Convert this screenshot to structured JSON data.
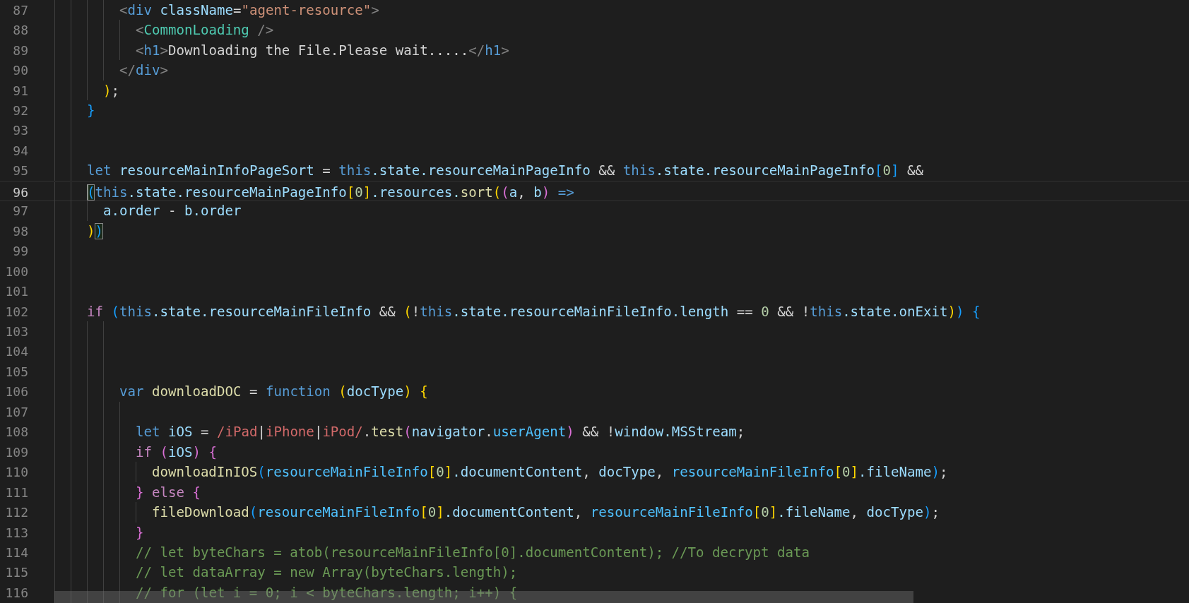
{
  "editor": {
    "lines": [
      {
        "number": "87",
        "current": false,
        "tokens": [
          {
            "text": "        <",
            "kind": "tag"
          },
          {
            "text": "div",
            "kind": "kw"
          },
          {
            "text": " className",
            "kind": "var"
          },
          {
            "text": "=",
            "kind": "plain"
          },
          {
            "text": "\"agent-resource\"",
            "kind": "str"
          },
          {
            "text": ">",
            "kind": "tag"
          }
        ]
      },
      {
        "number": "88",
        "current": false,
        "tokens": [
          {
            "text": "          <",
            "kind": "tag"
          },
          {
            "text": "CommonLoading",
            "kind": "comp"
          },
          {
            "text": " />",
            "kind": "tag"
          }
        ]
      },
      {
        "number": "89",
        "current": false,
        "tokens": [
          {
            "text": "          <",
            "kind": "tag"
          },
          {
            "text": "h1",
            "kind": "kw"
          },
          {
            "text": ">",
            "kind": "tag"
          },
          {
            "text": "Downloading the File.Please wait.....",
            "kind": "plain"
          },
          {
            "text": "</",
            "kind": "tag"
          },
          {
            "text": "h1",
            "kind": "kw"
          },
          {
            "text": ">",
            "kind": "tag"
          }
        ]
      },
      {
        "number": "90",
        "current": false,
        "tokens": [
          {
            "text": "        </",
            "kind": "tag"
          },
          {
            "text": "div",
            "kind": "kw"
          },
          {
            "text": ">",
            "kind": "tag"
          }
        ]
      },
      {
        "number": "91",
        "current": false,
        "tokens": [
          {
            "text": "      )",
            "kind": "b1"
          },
          {
            "text": ";",
            "kind": "plain"
          }
        ]
      },
      {
        "number": "92",
        "current": false,
        "tokens": [
          {
            "text": "    }",
            "kind": "b3"
          }
        ]
      },
      {
        "number": "93",
        "current": false
      },
      {
        "number": "94",
        "current": false
      },
      {
        "number": "95",
        "current": false,
        "tokens": [
          {
            "text": "    let",
            "kind": "kw"
          },
          {
            "text": " resourceMainInfoPageSort",
            "kind": "var"
          },
          {
            "text": " = ",
            "kind": "plain"
          },
          {
            "text": "this",
            "kind": "kw"
          },
          {
            "text": ".state.resourceMainPageInfo",
            "kind": "var"
          },
          {
            "text": " && ",
            "kind": "plain"
          },
          {
            "text": "this",
            "kind": "kw"
          },
          {
            "text": ".state.resourceMainPageInfo",
            "kind": "var"
          },
          {
            "text": "[",
            "kind": "b3"
          },
          {
            "text": "0",
            "kind": "num"
          },
          {
            "text": "]",
            "kind": "b3"
          },
          {
            "text": " &&",
            "kind": "plain"
          }
        ]
      },
      {
        "number": "96",
        "current": true,
        "tokens": [
          {
            "text": "    (",
            "kind": "b3",
            "matched": true
          },
          {
            "text": "this",
            "kind": "kw"
          },
          {
            "text": ".state.resourceMainPageInfo",
            "kind": "var"
          },
          {
            "text": "[",
            "kind": "b1"
          },
          {
            "text": "0",
            "kind": "num"
          },
          {
            "text": "]",
            "kind": "b1"
          },
          {
            "text": ".resources.",
            "kind": "var"
          },
          {
            "text": "sort",
            "kind": "fn"
          },
          {
            "text": "(",
            "kind": "b1"
          },
          {
            "text": "(",
            "kind": "b2"
          },
          {
            "text": "a",
            "kind": "var"
          },
          {
            "text": ", ",
            "kind": "plain"
          },
          {
            "text": "b",
            "kind": "var"
          },
          {
            "text": ")",
            "kind": "b2"
          },
          {
            "text": " =>",
            "kind": "kw"
          }
        ]
      },
      {
        "number": "97",
        "current": false,
        "tokens": [
          {
            "text": "      a.order",
            "kind": "var"
          },
          {
            "text": " - ",
            "kind": "plain"
          },
          {
            "text": "b.order",
            "kind": "var"
          }
        ]
      },
      {
        "number": "98",
        "current": false,
        "tokens": [
          {
            "text": "    )",
            "kind": "b1"
          },
          {
            "text": ")",
            "kind": "b3",
            "matched": true
          }
        ]
      },
      {
        "number": "99",
        "current": false
      },
      {
        "number": "100",
        "current": false
      },
      {
        "number": "101",
        "current": false
      },
      {
        "number": "102",
        "current": false,
        "tokens": [
          {
            "text": "    if ",
            "kind": "ctrl"
          },
          {
            "text": "(",
            "kind": "b3"
          },
          {
            "text": "this",
            "kind": "kw"
          },
          {
            "text": ".state.resourceMainFileInfo",
            "kind": "var"
          },
          {
            "text": " && ",
            "kind": "plain"
          },
          {
            "text": "(",
            "kind": "b1"
          },
          {
            "text": "!",
            "kind": "plain"
          },
          {
            "text": "this",
            "kind": "kw"
          },
          {
            "text": ".state.resourceMainFileInfo.length",
            "kind": "var"
          },
          {
            "text": " == ",
            "kind": "plain"
          },
          {
            "text": "0",
            "kind": "num"
          },
          {
            "text": " && !",
            "kind": "plain"
          },
          {
            "text": "this",
            "kind": "kw"
          },
          {
            "text": ".state.onExit",
            "kind": "var"
          },
          {
            "text": ")",
            "kind": "b1"
          },
          {
            "text": ") ",
            "kind": "b3"
          },
          {
            "text": "{",
            "kind": "b3"
          }
        ]
      },
      {
        "number": "103",
        "current": false
      },
      {
        "number": "104",
        "current": false
      },
      {
        "number": "105",
        "current": false
      },
      {
        "number": "106",
        "current": false,
        "tokens": [
          {
            "text": "        var",
            "kind": "kw"
          },
          {
            "text": " downloadDOC",
            "kind": "fn"
          },
          {
            "text": " = ",
            "kind": "plain"
          },
          {
            "text": "function ",
            "kind": "kw"
          },
          {
            "text": "(",
            "kind": "b1"
          },
          {
            "text": "docType",
            "kind": "var"
          },
          {
            "text": ") ",
            "kind": "b1"
          },
          {
            "text": "{",
            "kind": "b1"
          }
        ]
      },
      {
        "number": "107",
        "current": false
      },
      {
        "number": "108",
        "current": false,
        "tokens": [
          {
            "text": "          let",
            "kind": "kw"
          },
          {
            "text": " iOS",
            "kind": "var"
          },
          {
            "text": " = ",
            "kind": "plain"
          },
          {
            "text": "/iPad",
            "kind": "regex"
          },
          {
            "text": "|",
            "kind": "plain"
          },
          {
            "text": "iPhone",
            "kind": "regex"
          },
          {
            "text": "|",
            "kind": "plain"
          },
          {
            "text": "iPod/",
            "kind": "regex"
          },
          {
            "text": ".",
            "kind": "plain"
          },
          {
            "text": "test",
            "kind": "fn"
          },
          {
            "text": "(",
            "kind": "b2"
          },
          {
            "text": "navigator",
            "kind": "var"
          },
          {
            "text": ".",
            "kind": "plain"
          },
          {
            "text": "userAgent",
            "kind": "const"
          },
          {
            "text": ")",
            "kind": "b2"
          },
          {
            "text": " && !",
            "kind": "plain"
          },
          {
            "text": "window.MSStream",
            "kind": "var"
          },
          {
            "text": ";",
            "kind": "plain"
          }
        ]
      },
      {
        "number": "109",
        "current": false,
        "tokens": [
          {
            "text": "          if ",
            "kind": "ctrl"
          },
          {
            "text": "(",
            "kind": "b2"
          },
          {
            "text": "iOS",
            "kind": "var"
          },
          {
            "text": ") ",
            "kind": "b2"
          },
          {
            "text": "{",
            "kind": "b2"
          }
        ]
      },
      {
        "number": "110",
        "current": false,
        "tokens": [
          {
            "text": "            downloadInIOS",
            "kind": "fn"
          },
          {
            "text": "(",
            "kind": "b3"
          },
          {
            "text": "resourceMainFileInfo",
            "kind": "const"
          },
          {
            "text": "[",
            "kind": "b1"
          },
          {
            "text": "0",
            "kind": "num"
          },
          {
            "text": "]",
            "kind": "b1"
          },
          {
            "text": ".documentContent",
            "kind": "var"
          },
          {
            "text": ", ",
            "kind": "plain"
          },
          {
            "text": "docType",
            "kind": "var"
          },
          {
            "text": ", ",
            "kind": "plain"
          },
          {
            "text": "resourceMainFileInfo",
            "kind": "const"
          },
          {
            "text": "[",
            "kind": "b1"
          },
          {
            "text": "0",
            "kind": "num"
          },
          {
            "text": "]",
            "kind": "b1"
          },
          {
            "text": ".fileName",
            "kind": "var"
          },
          {
            "text": ")",
            "kind": "b3"
          },
          {
            "text": ";",
            "kind": "plain"
          }
        ]
      },
      {
        "number": "111",
        "current": false,
        "tokens": [
          {
            "text": "          } ",
            "kind": "b2"
          },
          {
            "text": "else ",
            "kind": "ctrl"
          },
          {
            "text": "{",
            "kind": "b2"
          }
        ]
      },
      {
        "number": "112",
        "current": false,
        "tokens": [
          {
            "text": "            fileDownload",
            "kind": "fn"
          },
          {
            "text": "(",
            "kind": "b3"
          },
          {
            "text": "resourceMainFileInfo",
            "kind": "const"
          },
          {
            "text": "[",
            "kind": "b1"
          },
          {
            "text": "0",
            "kind": "num"
          },
          {
            "text": "]",
            "kind": "b1"
          },
          {
            "text": ".documentContent",
            "kind": "var"
          },
          {
            "text": ", ",
            "kind": "plain"
          },
          {
            "text": "resourceMainFileInfo",
            "kind": "const"
          },
          {
            "text": "[",
            "kind": "b1"
          },
          {
            "text": "0",
            "kind": "num"
          },
          {
            "text": "]",
            "kind": "b1"
          },
          {
            "text": ".fileName",
            "kind": "var"
          },
          {
            "text": ", ",
            "kind": "plain"
          },
          {
            "text": "docType",
            "kind": "var"
          },
          {
            "text": ")",
            "kind": "b3"
          },
          {
            "text": ";",
            "kind": "plain"
          }
        ]
      },
      {
        "number": "113",
        "current": false,
        "tokens": [
          {
            "text": "          }",
            "kind": "b2"
          }
        ]
      },
      {
        "number": "114",
        "current": false,
        "tokens": [
          {
            "text": "          // let byteChars = atob(resourceMainFileInfo[0].documentContent); //To decrypt data",
            "kind": "cmt"
          }
        ]
      },
      {
        "number": "115",
        "current": false,
        "tokens": [
          {
            "text": "          // let dataArray = new Array(byteChars.length);",
            "kind": "cmt"
          }
        ]
      },
      {
        "number": "116",
        "current": false,
        "tokens": [
          {
            "text": "          // for (let i = 0; i < byteChars.length; i++) {",
            "kind": "cmt"
          }
        ]
      }
    ]
  }
}
